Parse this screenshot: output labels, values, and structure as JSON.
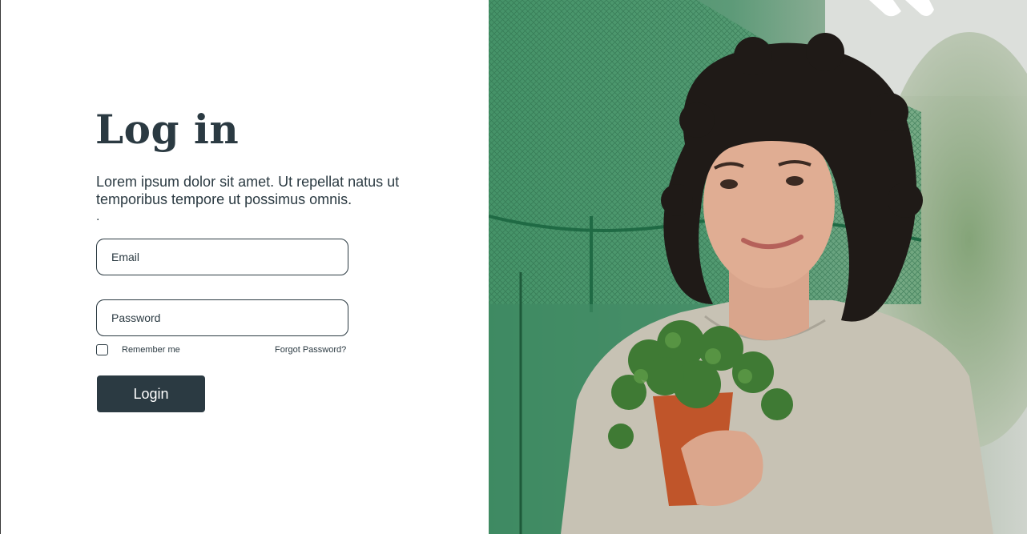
{
  "login": {
    "title": "Log in",
    "description": "Lorem ipsum dolor sit amet. Ut repellat natus ut temporibus tempore ut possimus omnis.",
    "description_suffix": ".",
    "email_placeholder": "Email",
    "password_placeholder": "Password",
    "remember_label": "Remember me",
    "remember_checked": false,
    "forgot_label": "Forgot Password?",
    "login_button": "Login"
  },
  "photo": {
    "subject": "woman-holding-potted-plant-photo"
  },
  "colors": {
    "primary": "#2b3a42",
    "background": "#ffffff",
    "button_text": "#ffffff"
  }
}
